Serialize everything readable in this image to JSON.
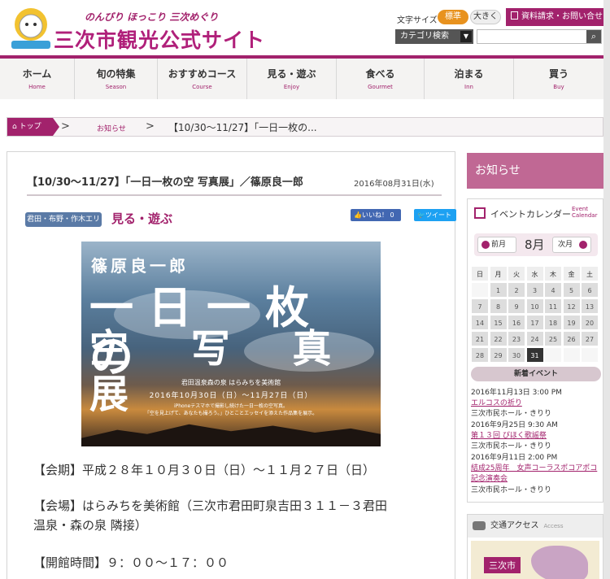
{
  "header": {
    "tagline": "のんびり ほっこり 三次めぐり",
    "site_title": "三次市観光公式サイト",
    "font_size_label": "文字サイズ",
    "font_size_standard": "標準",
    "font_size_large": "大きく",
    "request_button": "資料請求・お問い合せ",
    "category_search": "カテゴリ検索",
    "search_placeholder": ""
  },
  "nav": [
    {
      "jp": "ホーム",
      "en": "Home"
    },
    {
      "jp": "旬の特集",
      "en": "Season"
    },
    {
      "jp": "おすすめコース",
      "en": "Course"
    },
    {
      "jp": "見る・遊ぶ",
      "en": "Enjoy"
    },
    {
      "jp": "食べる",
      "en": "Gourmet"
    },
    {
      "jp": "泊まる",
      "en": "Inn"
    },
    {
      "jp": "買う",
      "en": "Buy"
    }
  ],
  "breadcrumb": {
    "home": "トップ",
    "sep1": ">",
    "news": "お知らせ",
    "sep2": ">",
    "current": "【10/30～11/27】「一日一枚の..."
  },
  "article": {
    "title": "【10/30～11/27】「一日一枚の空 写真展」／篠原良一郎",
    "date": "2016年08月31日(水)",
    "area_tag": "君田・布野・作木エリア",
    "category": "見る・遊ぶ",
    "like_label": "いいね！ 0",
    "tweet_label": "ツイート",
    "poster": {
      "artist": "篠原良一郎",
      "headline1": "一日一枚の",
      "headline2": "空 写 真 展",
      "venue": "君田温泉森の泉 はらみちを美術館",
      "dates": "2016年10月30日（日）〜11月27日（日）",
      "desc1": "iPhoneテスマホで撮影し続けた一日一枚の空写真。",
      "desc2": "「空を見上げて、あなたも撮ろう。」ひとことエッセイを添えた作品集を展示。"
    },
    "period": "【会期】平成２８年１０月３０日（日）～１１月２７日（日）",
    "venue_line1": "【会場】はらみちを美術館（三次市君田町泉吉田３１１－３君田",
    "venue_line2": "温泉・森の泉 隣接）",
    "hours": "【開館時間】９：００～１７：００"
  },
  "sidebar": {
    "news_heading": "お知らせ",
    "calendar_title": "イベントカレンダー",
    "calendar_title_en_1": "Event",
    "calendar_title_en_2": "Calendar",
    "prev_label": "前月",
    "month": "8月",
    "next_label": "次月",
    "weekdays": [
      "日",
      "月",
      "火",
      "水",
      "木",
      "金",
      "土"
    ],
    "weeks": [
      [
        "",
        "1",
        "2",
        "3",
        "4",
        "5",
        "6"
      ],
      [
        "7",
        "8",
        "9",
        "10",
        "11",
        "12",
        "13"
      ],
      [
        "14",
        "15",
        "16",
        "17",
        "18",
        "19",
        "20"
      ],
      [
        "21",
        "22",
        "23",
        "24",
        "25",
        "26",
        "27"
      ],
      [
        "28",
        "29",
        "30",
        "31",
        "",
        "",
        ""
      ]
    ],
    "today": "31",
    "new_events_heading": "新着イベント",
    "events": [
      {
        "date": "2016年11月13日 3:00 PM",
        "title": "エルコスの祈り",
        "place": "三次市民ホール・きりり"
      },
      {
        "date": "2016年9月25日 9:30 AM",
        "title": "第１３回 ぴほく歌謡祭",
        "place": "三次市民ホール・きりり"
      },
      {
        "date": "2016年9月11日 2:00 PM",
        "title": "結成25周年　女声コーラスポコアポコ記念演奏会",
        "place": "三次市民ホール・きりり"
      }
    ],
    "access_heading": "交通アクセス",
    "access_heading_en": "Access",
    "map_label": "三次市"
  }
}
